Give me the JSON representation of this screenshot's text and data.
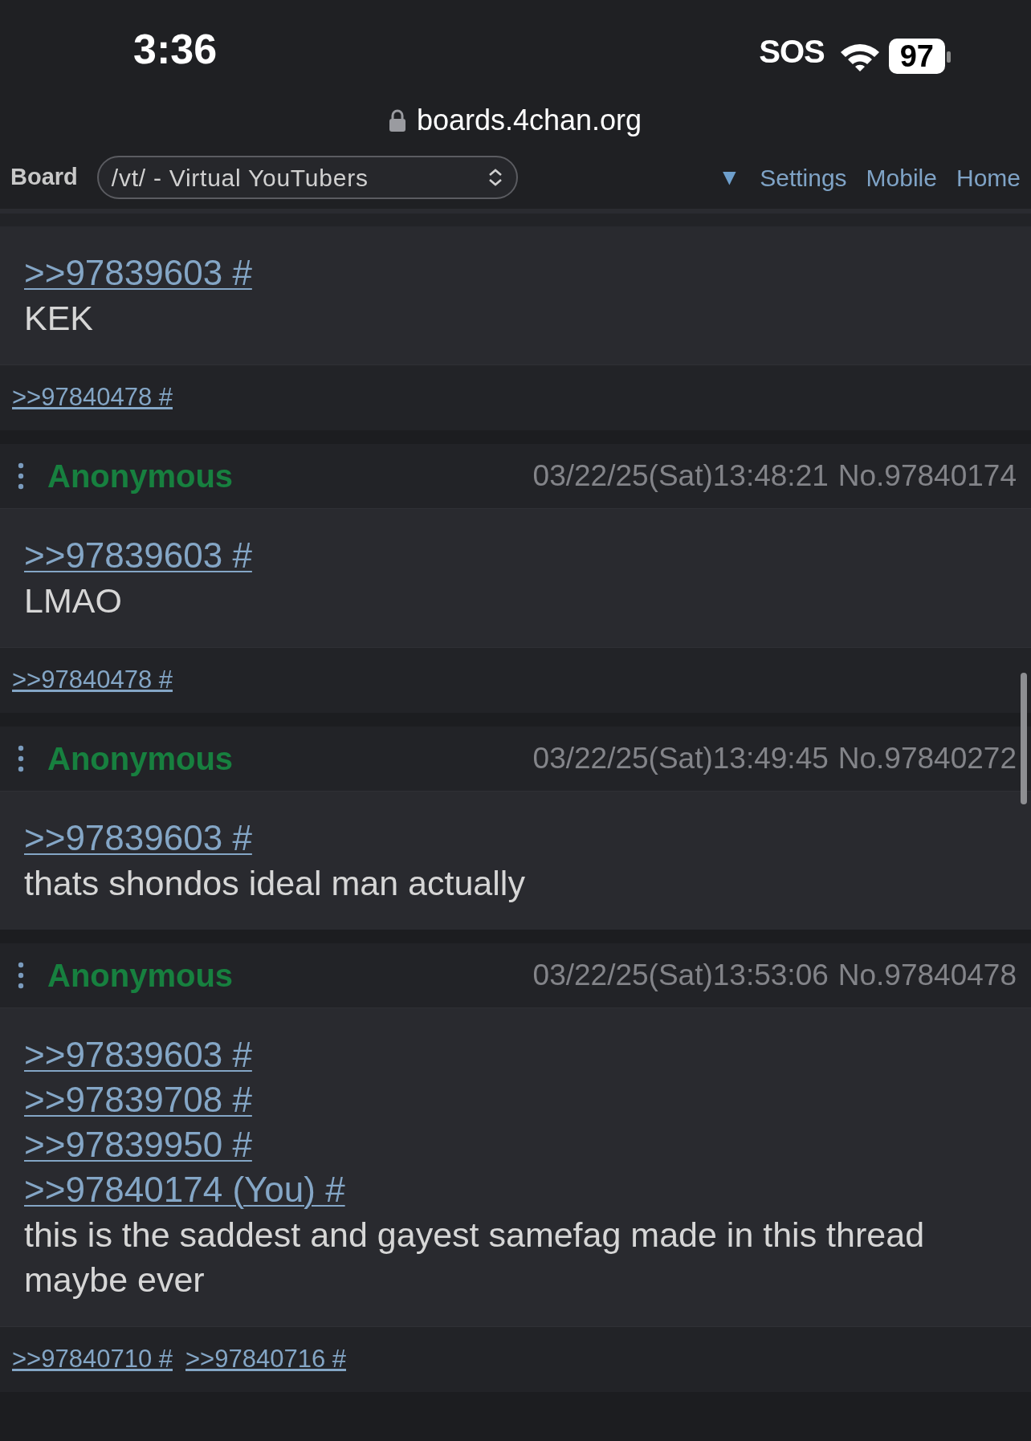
{
  "status_bar": {
    "time": "3:36",
    "sos": "SOS",
    "battery": "97"
  },
  "address_bar": {
    "url": "boards.4chan.org"
  },
  "nav": {
    "board_label": "Board",
    "board_select": "/vt/ - Virtual YouTubers",
    "toggle": "▼",
    "links": [
      "Settings",
      "Mobile",
      "Home"
    ]
  },
  "posts": [
    {
      "quotes": [
        ">>97839603 #"
      ],
      "text": "KEK",
      "backlinks": [
        ">>97840478 #"
      ]
    },
    {
      "header": {
        "name": "Anonymous",
        "datetime": "03/22/25(Sat)13:48:21",
        "number": "No.97840174"
      },
      "quotes": [
        ">>97839603 #"
      ],
      "text": "LMAO",
      "backlinks": [
        ">>97840478 #"
      ]
    },
    {
      "header": {
        "name": "Anonymous",
        "datetime": "03/22/25(Sat)13:49:45",
        "number": "No.97840272"
      },
      "quotes": [
        ">>97839603 #"
      ],
      "text": "thats shondos ideal man actually"
    },
    {
      "header": {
        "name": "Anonymous",
        "datetime": "03/22/25(Sat)13:53:06",
        "number": "No.97840478"
      },
      "quotes": [
        ">>97839603 #",
        ">>97839708 #",
        ">>97839950 #",
        ">>97840174 (You) #"
      ],
      "text": "this is the saddest and gayest samefag made in this thread maybe ever",
      "backlinks": [
        ">>97840710 #",
        ">>97840716 #"
      ]
    }
  ]
}
